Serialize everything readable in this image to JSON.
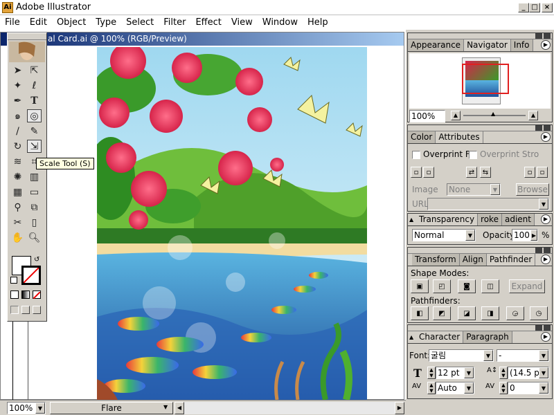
{
  "window": {
    "title": "Adobe Illustrator"
  },
  "menus": [
    "File",
    "Edit",
    "Object",
    "Type",
    "Select",
    "Filter",
    "Effect",
    "View",
    "Window",
    "Help"
  ],
  "document": {
    "title": "al Card.ai @ 100% (RGB/Preview)"
  },
  "tooltip": "Scale Tool (S)",
  "status": {
    "zoom": "100%",
    "tool_label": "Flare"
  },
  "navigator": {
    "tabs": [
      "Appearance",
      "Navigator",
      "Info"
    ],
    "zoom": "100%"
  },
  "color_palette": {
    "tabs": [
      "Color",
      "Attributes"
    ],
    "overprint_fill": "Overprint F",
    "overprint_stroke": "Overprint Stro",
    "image_label": "Image",
    "image_value": "None",
    "browse": "Browse",
    "url_label": "URL"
  },
  "transparency": {
    "tabs": [
      "Transparency",
      "roke",
      "adient"
    ],
    "blend_mode": "Normal",
    "opacity_label": "Opacity",
    "opacity_value": "100",
    "opacity_unit": "%"
  },
  "pathfinder": {
    "tabs": [
      "Transform",
      "Align",
      "Pathfinder"
    ],
    "shape_modes": "Shape Modes:",
    "expand": "Expand",
    "pathfinders": "Pathfinders:"
  },
  "character": {
    "tabs": [
      "Character",
      "Paragraph"
    ],
    "font_label": "Font:",
    "font_value": "굴림",
    "style_value": "-",
    "size": "12 pt",
    "leading": "(14.5 p",
    "kerning": "Auto",
    "tracking": "0"
  }
}
